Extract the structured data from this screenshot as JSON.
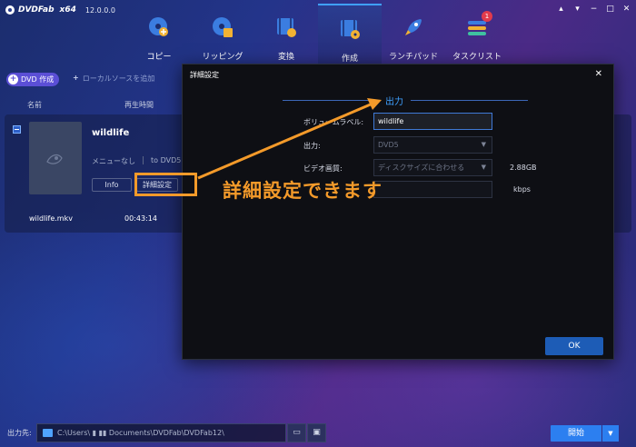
{
  "app": {
    "brand": "DVDFab",
    "arch": "x64",
    "version": "12.0.0.0"
  },
  "modules": [
    {
      "label": "コピー",
      "icon": "disc-copy-icon"
    },
    {
      "label": "リッピング",
      "icon": "film-disc-icon"
    },
    {
      "label": "変換",
      "icon": "film-convert-icon"
    },
    {
      "label": "作成",
      "icon": "film-create-icon"
    },
    {
      "label": "ランチパッド",
      "icon": "rocket-icon"
    },
    {
      "label": "タスクリスト",
      "icon": "task-list-icon",
      "badge": "1"
    }
  ],
  "toolbar": {
    "dvd_create": "DVD 作成",
    "add_local": "ローカルソースを追加"
  },
  "columns": {
    "name": "名前",
    "duration": "再生時間"
  },
  "file": {
    "title": "wildlife",
    "menu": "メニューなし",
    "target": "to DVD5",
    "info_btn": "Info",
    "advanced_btn": "詳細設定",
    "track_name": "wildlife.mkv",
    "track_time": "00:43:14"
  },
  "dialog": {
    "title": "詳細設定",
    "section": "出力",
    "volume_label": "ボリュームラベル:",
    "volume_value": "wildlife",
    "output_label": "出力:",
    "output_value": "DVD5",
    "quality_label": "ビデオ画質:",
    "quality_value": "ディスクサイズに合わせる",
    "size": "2.88GB",
    "bitrate_unit": "kbps",
    "ok": "OK"
  },
  "annotation": "詳細設定できます",
  "footer": {
    "label": "出力先:",
    "path": "C:\\Users\\  ▮  ▮▮  Documents\\DVDFab\\DVDFab12\\",
    "start": "開始"
  },
  "colors": {
    "accent": "#3fa0ff",
    "annotation": "#f39a2a",
    "primary_button": "#2c7ff0",
    "dvd_button": "#5b4fd6",
    "badge": "#e23b4c"
  }
}
